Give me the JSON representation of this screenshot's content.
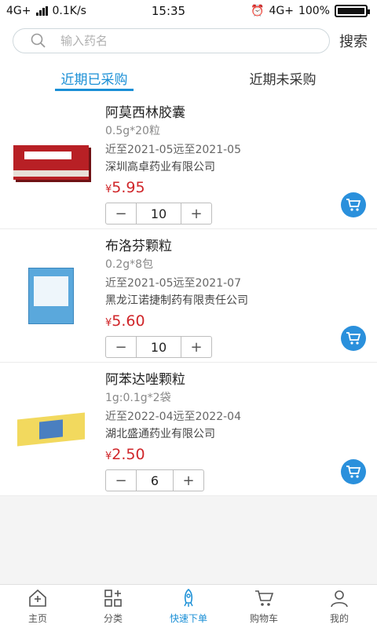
{
  "status": {
    "network": "4G+",
    "speed": "0.1K/s",
    "time": "15:35",
    "network_right": "4G+",
    "battery": "100%"
  },
  "search": {
    "placeholder": "输入药名",
    "button": "搜索"
  },
  "tabs": [
    {
      "label": "近期已采购",
      "active": true
    },
    {
      "label": "近期未采购",
      "active": false
    }
  ],
  "products": [
    {
      "name": "阿莫西林胶囊",
      "spec": "0.5g*20粒",
      "expiry": "近至2021-05远至2021-05",
      "maker": "深圳高卓药业有限公司",
      "currency": "¥",
      "price": "5.95",
      "qty": "10"
    },
    {
      "name": "布洛芬颗粒",
      "spec": "0.2g*8包",
      "expiry": "近至2021-05远至2021-07",
      "maker": "黑龙江诺捷制药有限责任公司",
      "currency": "¥",
      "price": "5.60",
      "qty": "10"
    },
    {
      "name": "阿苯达唑颗粒",
      "spec": "1g:0.1g*2袋",
      "expiry": "近至2022-04远至2022-04",
      "maker": "湖北盛通药业有限公司",
      "currency": "¥",
      "price": "2.50",
      "qty": "6"
    }
  ],
  "stepper": {
    "minus": "−",
    "plus": "+"
  },
  "nav": [
    {
      "label": "主页",
      "icon": "home-icon"
    },
    {
      "label": "分类",
      "icon": "category-icon"
    },
    {
      "label": "快速下单",
      "icon": "rocket-icon",
      "active": true
    },
    {
      "label": "购物车",
      "icon": "cart-icon"
    },
    {
      "label": "我的",
      "icon": "user-icon"
    }
  ],
  "colors": {
    "accent": "#1a8fd6",
    "price": "#d0262a",
    "cart": "#2a90dc"
  }
}
